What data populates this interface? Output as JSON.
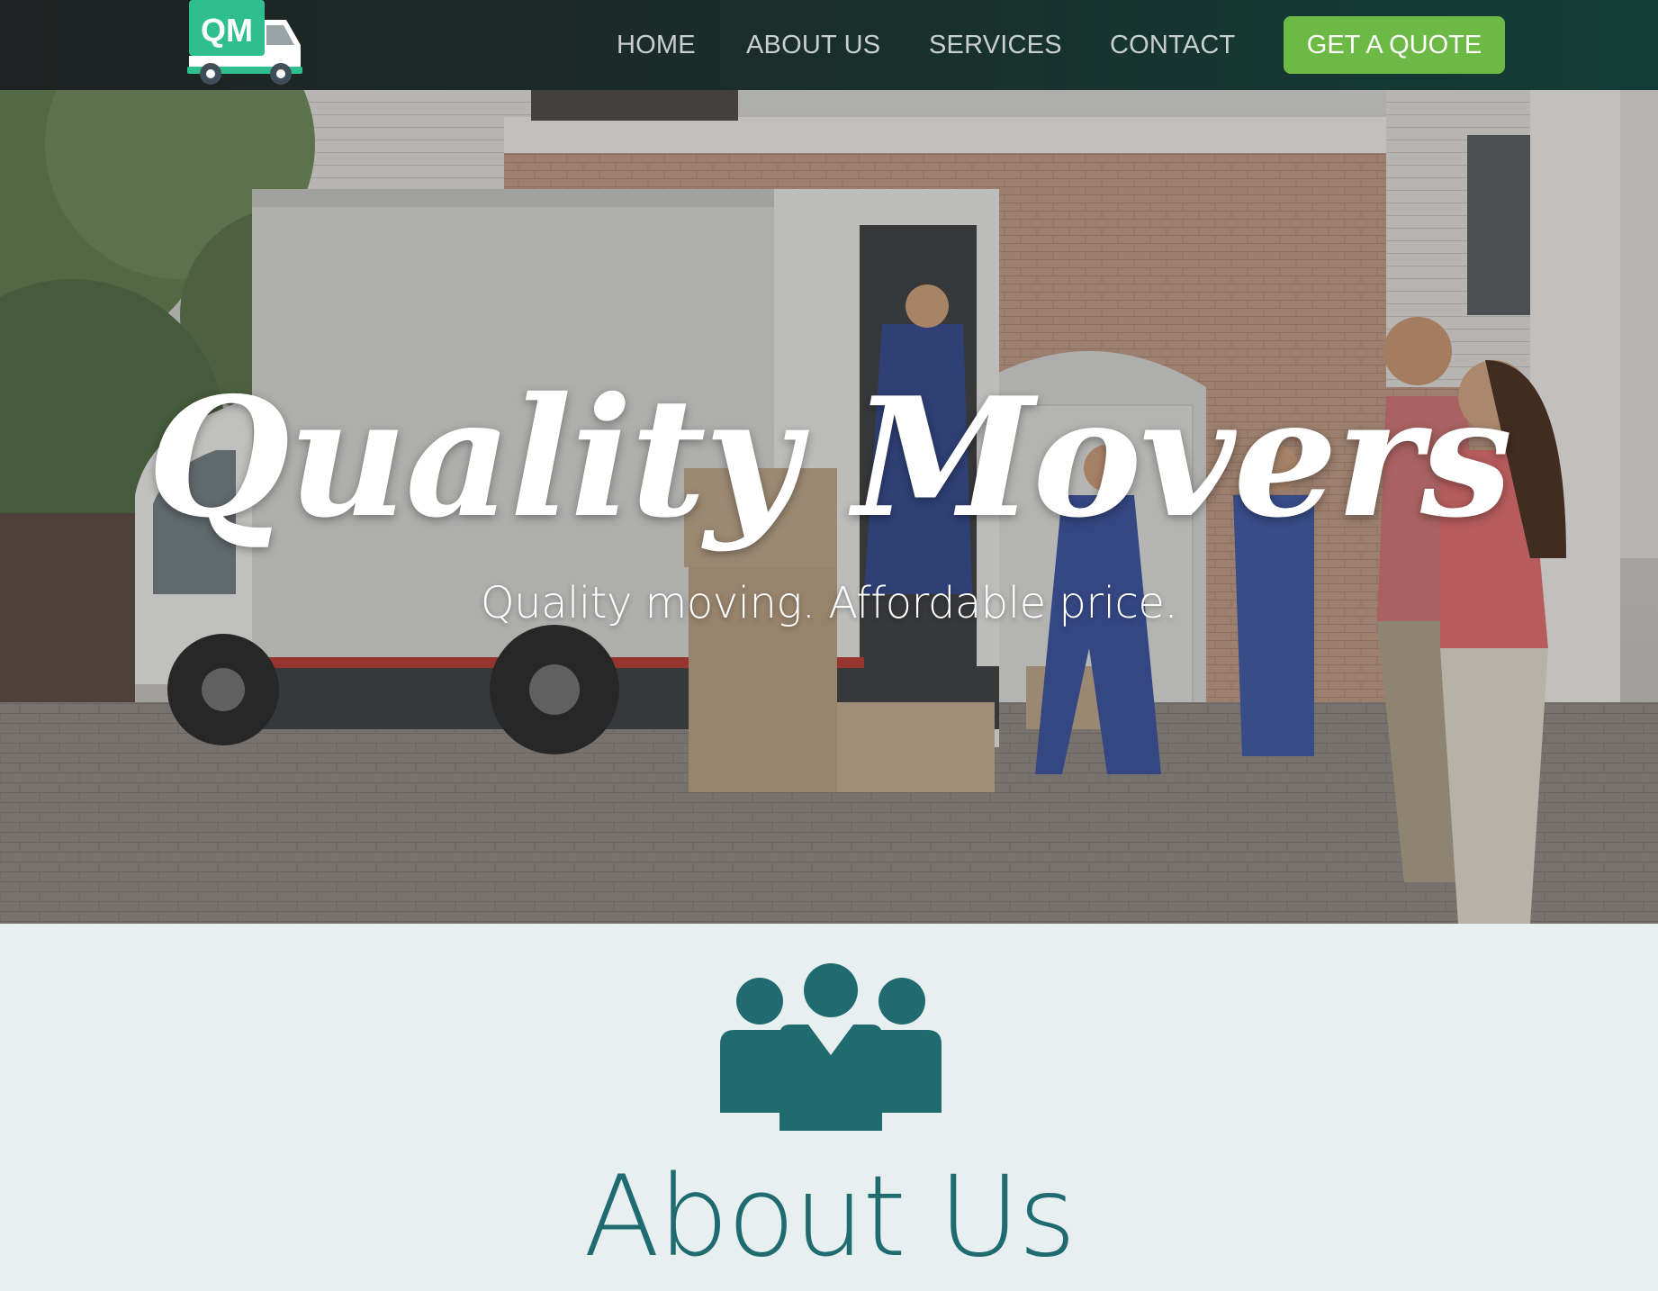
{
  "brand": {
    "logo_text": "QM"
  },
  "nav": {
    "items": [
      {
        "label": "HOME"
      },
      {
        "label": "ABOUT US"
      },
      {
        "label": "SERVICES"
      },
      {
        "label": "CONTACT"
      }
    ],
    "cta_label": "GET A QUOTE"
  },
  "hero": {
    "title": "Quality Movers",
    "subtitle": "Quality moving. Affordable price."
  },
  "about": {
    "title": "About Us",
    "icon": "team-icon"
  },
  "colors": {
    "nav_bg": "#1a2d2a",
    "nav_text": "#c9cfcd",
    "cta_green": "#6cb945",
    "logo_teal": "#2fbf8f",
    "section_bg": "#e8eff1",
    "accent_teal": "#1f6b70"
  }
}
